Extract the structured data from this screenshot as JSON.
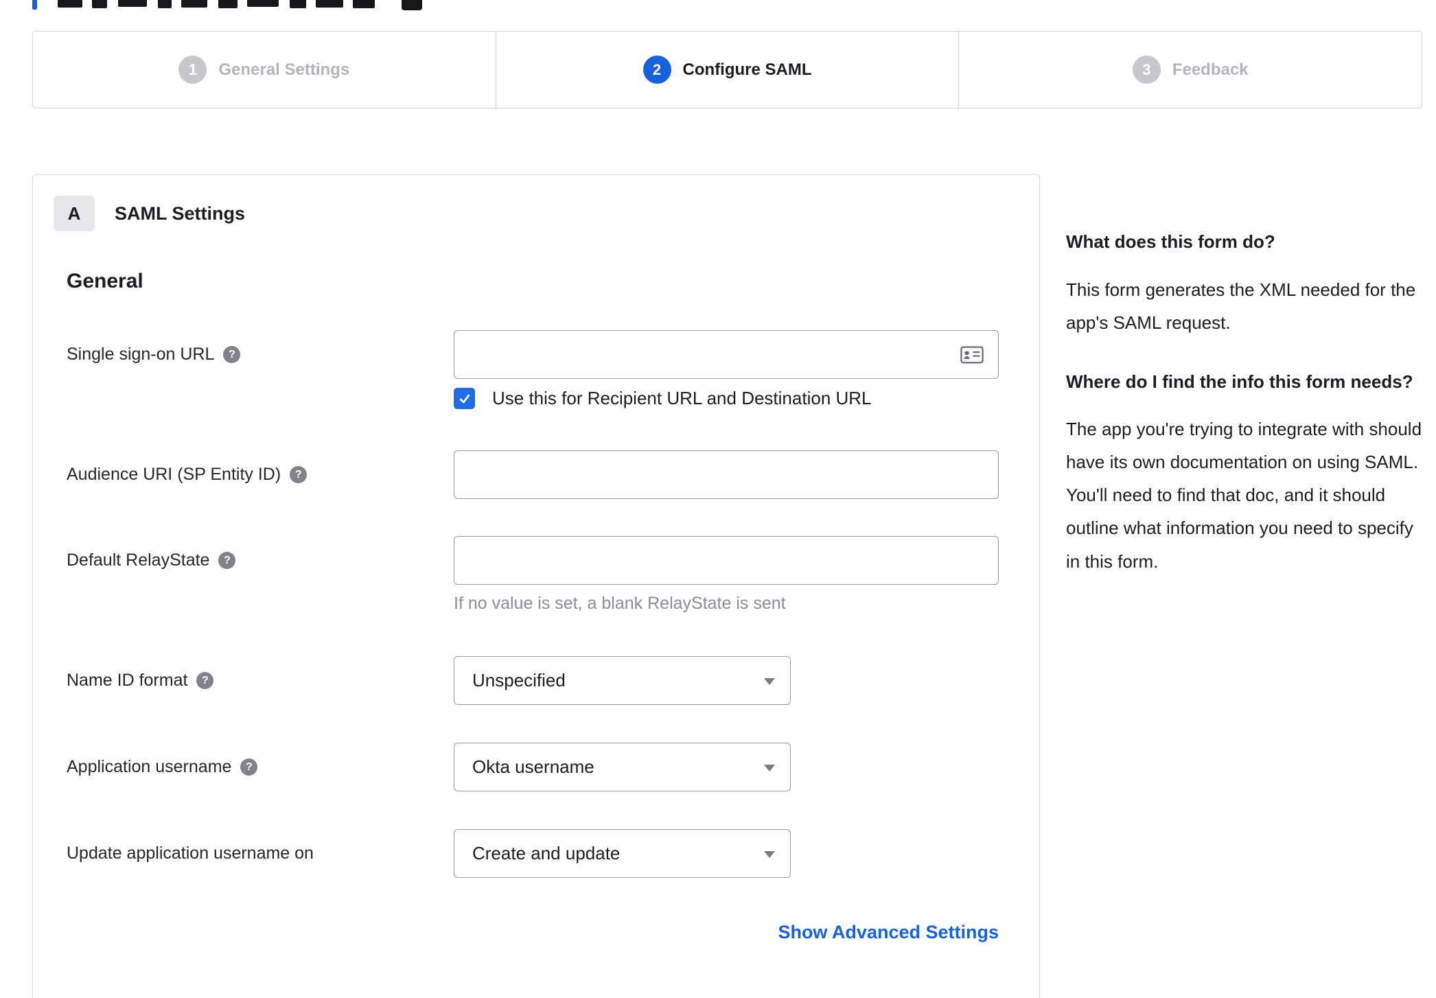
{
  "stepper": {
    "steps": [
      {
        "number": "1",
        "label": "General Settings",
        "state": "inactive"
      },
      {
        "number": "2",
        "label": "Configure SAML",
        "state": "active"
      },
      {
        "number": "3",
        "label": "Feedback",
        "state": "inactive"
      }
    ]
  },
  "panel": {
    "section_badge": "A",
    "section_title": "SAML Settings",
    "group_title": "General",
    "fields": {
      "sso_url": {
        "label": "Single sign-on URL",
        "value": "",
        "has_help": true
      },
      "sso_checkbox": {
        "label": "Use this for Recipient URL and Destination URL",
        "checked": true
      },
      "audience_uri": {
        "label": "Audience URI (SP Entity ID)",
        "value": "",
        "has_help": true
      },
      "relay_state": {
        "label": "Default RelayState",
        "value": "",
        "help_text": "If no value is set, a blank RelayState is sent",
        "has_help": true
      },
      "name_id_format": {
        "label": "Name ID format",
        "value": "Unspecified",
        "has_help": true
      },
      "app_username": {
        "label": "Application username",
        "value": "Okta username",
        "has_help": true
      },
      "update_app_username": {
        "label": "Update application username on",
        "value": "Create and update"
      }
    },
    "advanced_link": "Show Advanced Settings"
  },
  "sidebar": {
    "q1": "What does this form do?",
    "a1": "This form generates the XML needed for the app's SAML request.",
    "q2": "Where do I find the info this form needs?",
    "a2": "The app you're trying to integrate with should have its own documentation on using SAML. You'll need to find that doc, and it should outline what information you need to specify in this form."
  },
  "colors": {
    "accent": "#1662dd",
    "checkbox_blue": "#1f6ce8",
    "inactive_gray": "#c7c7cd"
  }
}
